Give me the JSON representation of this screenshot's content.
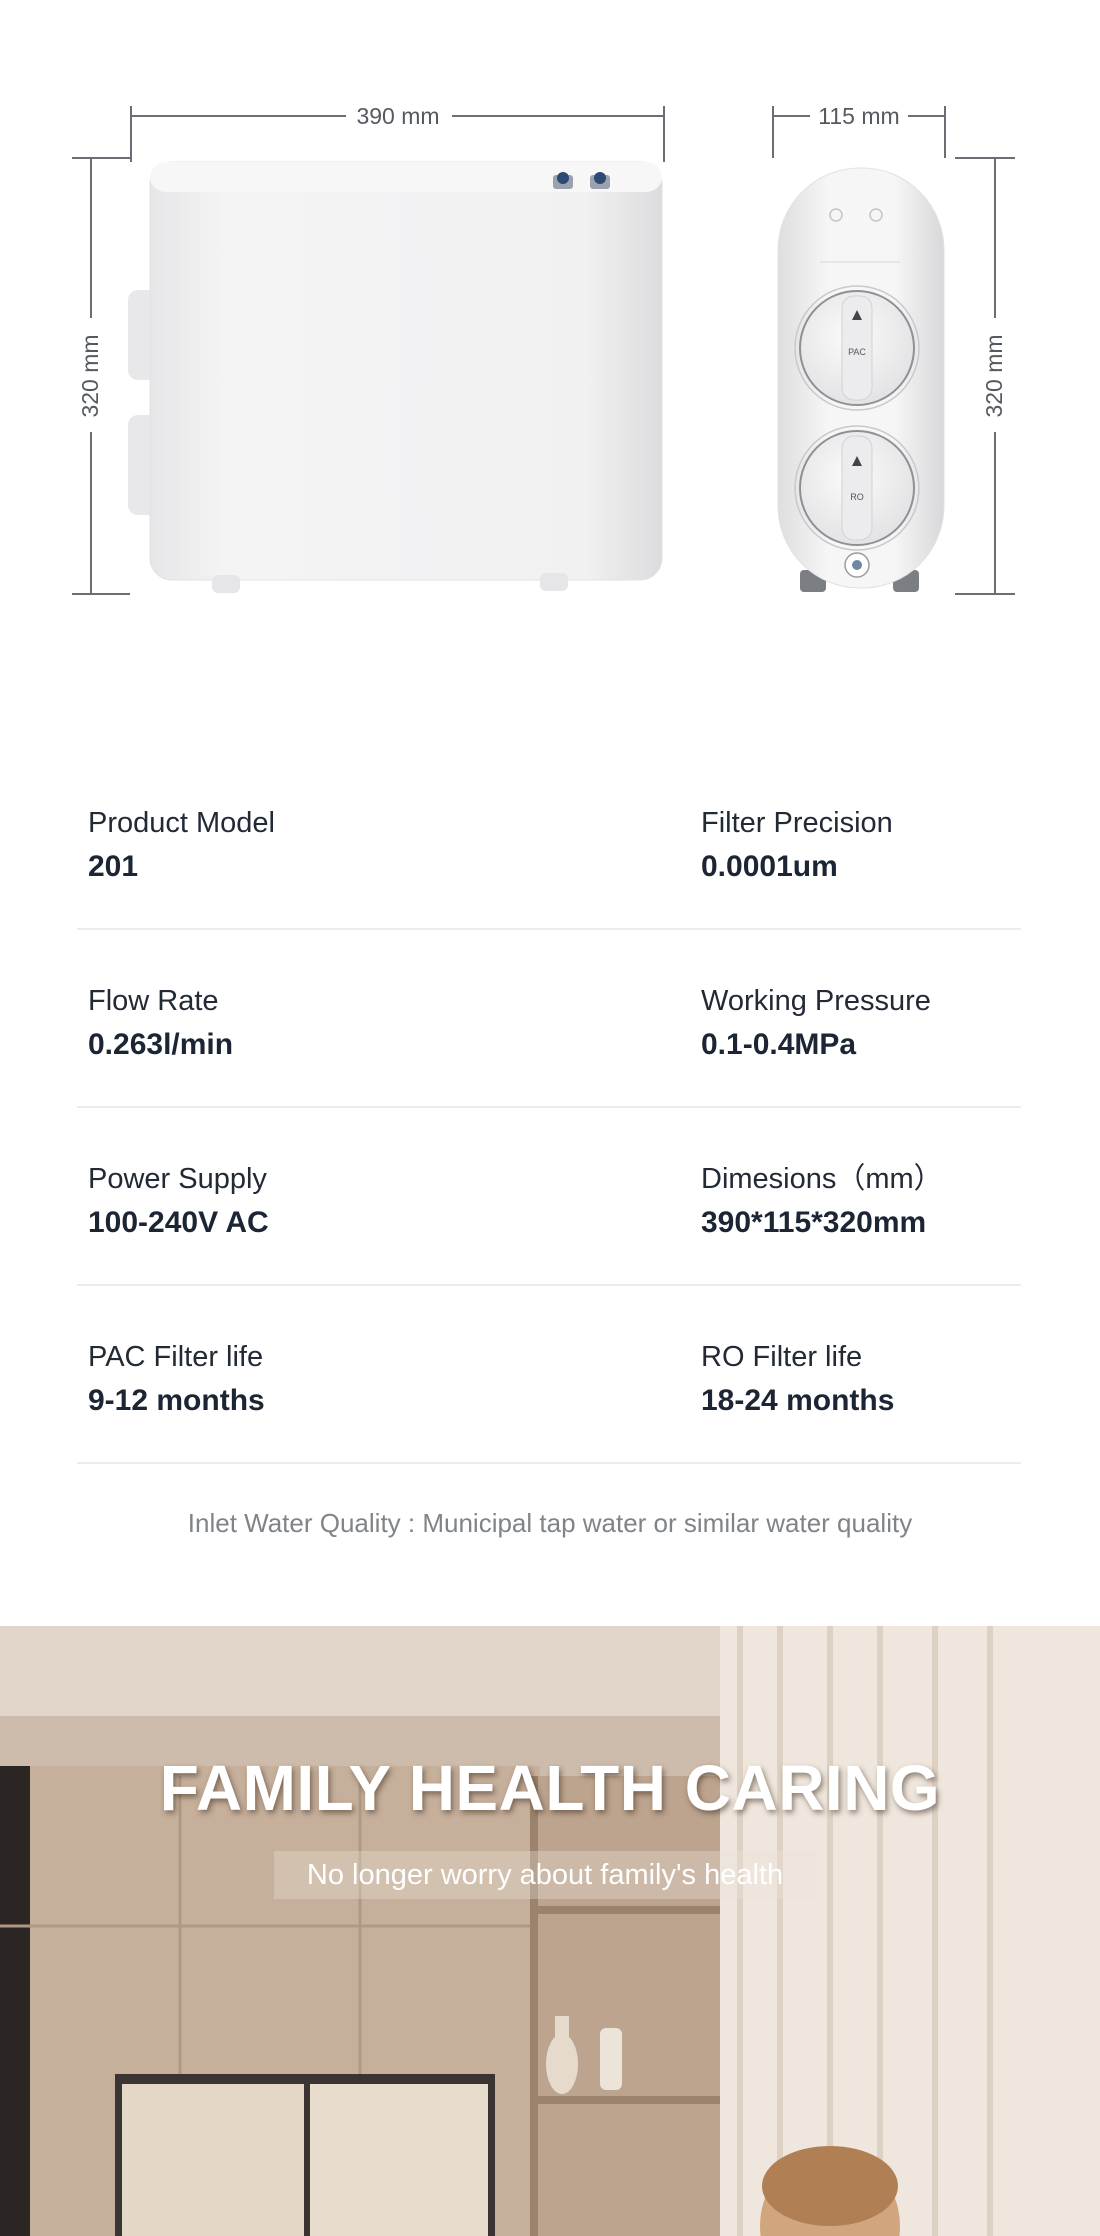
{
  "figure": {
    "width_label": "390 mm",
    "depth_label": "115 mm",
    "height_label_left": "320 mm",
    "height_label_right": "320 mm",
    "knob_top_label": "PAC",
    "knob_bottom_label": "RO"
  },
  "specs": [
    {
      "left": {
        "label": "Product Model",
        "value": "201"
      },
      "right": {
        "label": "Filter Precision",
        "value": "0.0001um"
      }
    },
    {
      "left": {
        "label": "Flow Rate",
        "value": "0.263l/min"
      },
      "right": {
        "label": "Working Pressure",
        "value": "0.1-0.4MPa"
      }
    },
    {
      "left": {
        "label": "Power Supply",
        "value": "100-240V AC"
      },
      "right": {
        "label": "Dimesions（mm）",
        "value": "390*115*320mm"
      }
    },
    {
      "left": {
        "label": "PAC Filter life",
        "value": "9-12 months"
      },
      "right": {
        "label": "RO Filter life",
        "value": "18-24 months"
      }
    }
  ],
  "inlet_note": "Inlet Water Quality : Municipal tap water or similar water quality",
  "banner": {
    "title": "FAMILY HEALTH CARING",
    "subtitle": "No longer worry about family's health"
  }
}
